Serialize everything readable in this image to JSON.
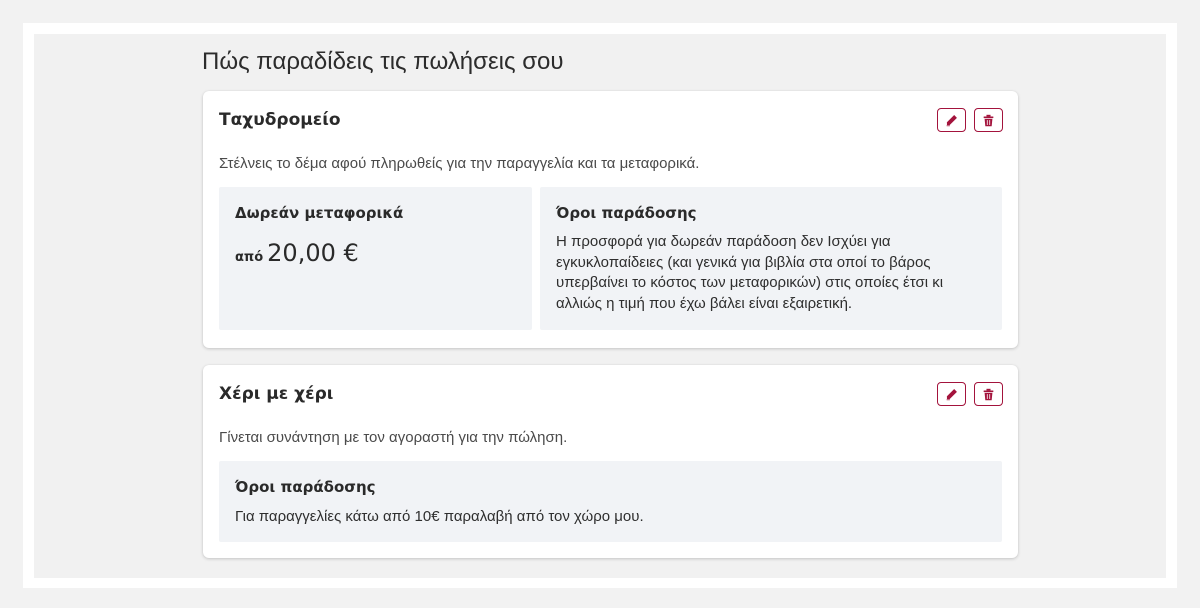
{
  "section": {
    "title": "Πώς παραδίδεις τις πωλήσεις σου"
  },
  "colors": {
    "accent": "#a3133c",
    "panel_bg": "#f1f3f6",
    "page_bg": "#f1f1f1"
  },
  "methods": [
    {
      "title": "Ταχυδρομείο",
      "description": "Στέλνεις το δέμα αφού πληρωθείς για την παραγγελία και τα μεταφορικά.",
      "free_shipping": {
        "heading": "Δωρεάν μεταφορικά",
        "prefix": "από",
        "amount": "20,00 €"
      },
      "terms": {
        "heading": "Όροι παράδοσης",
        "text": "Η προσφορά για δωρεάν παράδοση δεν Ισχύει για εγκυκλοπαίδειες (και γενικά για βιβλία στα οποί το βάρος υπερβαίνει το κόστος των μεταφορικών) στις οποίες έτσι κι αλλιώς η τιμή που έχω βάλει είναι εξαιρετική."
      },
      "icons": {
        "edit": "pencil-icon",
        "delete": "trash-icon"
      }
    },
    {
      "title": "Χέρι με χέρι",
      "description": "Γίνεται συνάντηση με τον αγοραστή για την πώληση.",
      "terms": {
        "heading": "Όροι παράδοσης",
        "text": "Για παραγγελίες κάτω από 10€ παραλαβή από τον χώρο μου."
      },
      "icons": {
        "edit": "pencil-icon",
        "delete": "trash-icon"
      }
    }
  ]
}
